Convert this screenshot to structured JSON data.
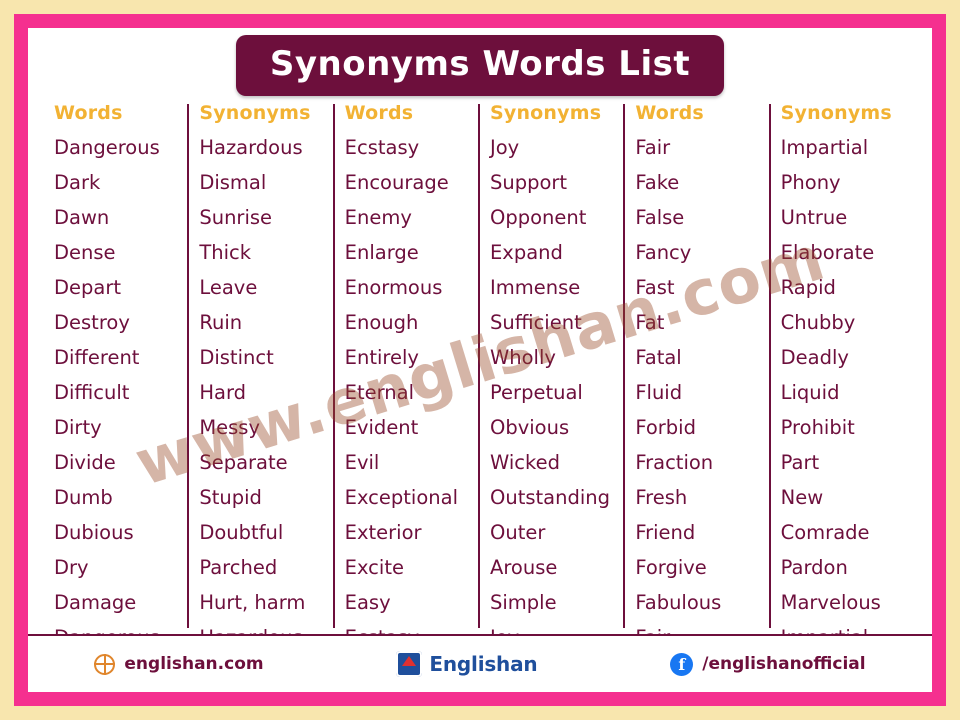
{
  "title": "Synonyms Words List",
  "columns": [
    {
      "header": "Words",
      "cells": [
        "Dangerous",
        "Dark",
        "Dawn",
        "Dense",
        "Depart",
        "Destroy",
        "Different",
        "Difficult",
        "Dirty",
        "Divide",
        "Dumb",
        "Dubious",
        "Dry",
        "Damage",
        "Dangerous"
      ]
    },
    {
      "header": "Synonyms",
      "cells": [
        "Hazardous",
        "Dismal",
        "Sunrise",
        "Thick",
        "Leave",
        "Ruin",
        "Distinct",
        "Hard",
        "Messy",
        "Separate",
        "Stupid",
        "Doubtful",
        "Parched",
        "Hurt, harm",
        "Hazardous"
      ]
    },
    {
      "header": "Words",
      "cells": [
        "Ecstasy",
        "Encourage",
        "Enemy",
        "Enlarge",
        "Enormous",
        "Enough",
        "Entirely",
        "Eternal",
        "Evident",
        "Evil",
        "Exceptional",
        "Exterior",
        "Excite",
        "Easy",
        "Ecstasy"
      ]
    },
    {
      "header": "Synonyms",
      "cells": [
        "Joy",
        "Support",
        "Opponent",
        "Expand",
        "Immense",
        "Sufficient",
        "Wholly",
        "Perpetual",
        "Obvious",
        "Wicked",
        "Outstanding",
        "Outer",
        "Arouse",
        "Simple",
        "Joy"
      ]
    },
    {
      "header": "Words",
      "cells": [
        "Fair",
        "Fake",
        "False",
        "Fancy",
        "Fast",
        "Fat",
        "Fatal",
        "Fluid",
        "Forbid",
        "Fraction",
        "Fresh",
        "Friend",
        "Forgive",
        "Fabulous",
        "Fair"
      ]
    },
    {
      "header": "Synonyms",
      "cells": [
        "Impartial",
        "Phony",
        "Untrue",
        "Elaborate",
        "Rapid",
        "Chubby",
        "Deadly",
        "Liquid",
        "Prohibit",
        "Part",
        "New",
        "Comrade",
        "Pardon",
        "Marvelous",
        "Impartial"
      ]
    }
  ],
  "watermark": "www.englishan.com",
  "footer": {
    "website": "englishan.com",
    "brand": "Englishan",
    "facebook": "/englishanofficial"
  },
  "colors": {
    "frame_pink": "#f5308f",
    "outer_cream": "#f8e6ae",
    "maroon": "#6d0f3c",
    "gold": "#f2b233"
  }
}
